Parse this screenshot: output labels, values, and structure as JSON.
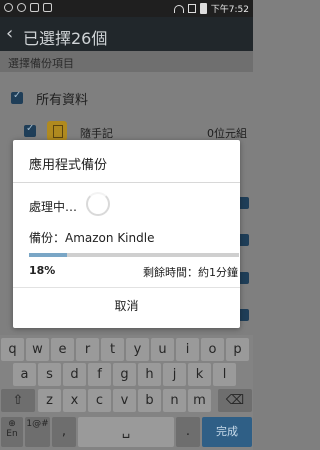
{
  "status_bar": {
    "time": "下午7:52"
  },
  "title_bar": {
    "back_glyph": "‹",
    "title": "已選擇26個"
  },
  "content": {
    "section_header": "選擇備份項目",
    "all_data_label": "所有資料",
    "note_item": {
      "label": "隨手記",
      "size": "0位元組"
    }
  },
  "dialog": {
    "title": "應用程式備份",
    "processing_label": "處理中…",
    "backup_label": "備份：Amazon Kindle",
    "progress_fraction": 0.18,
    "percent_text": "18%",
    "remaining_text": "剩餘時間：約1分鐘",
    "cancel_label": "取消"
  },
  "keyboard": {
    "row1": [
      "q",
      "w",
      "e",
      "r",
      "t",
      "y",
      "u",
      "i",
      "o",
      "p"
    ],
    "row2": [
      "a",
      "s",
      "d",
      "f",
      "g",
      "h",
      "j",
      "k",
      "l"
    ],
    "row3": [
      "z",
      "x",
      "c",
      "v",
      "b",
      "n",
      "m"
    ],
    "mode_keys": {
      "lang": "En",
      "symbols": "1@#",
      "comma": ",",
      "period": ".",
      "done": "完成"
    },
    "shift_icon": "shift-arrow-icon",
    "backspace_icon": "backspace-icon",
    "space_icon": "space-bar-icon"
  },
  "colors": {
    "title_bar": "#21272b",
    "accent_blue": "#2f5f86",
    "progress": "#7aa6c6"
  }
}
